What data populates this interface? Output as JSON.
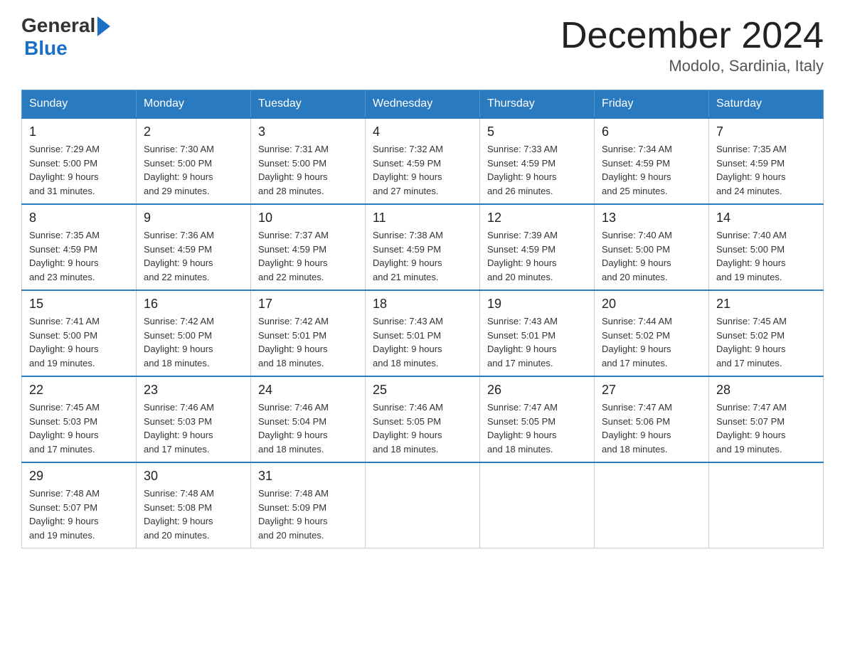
{
  "logo": {
    "general": "General",
    "blue": "Blue"
  },
  "title": "December 2024",
  "location": "Modolo, Sardinia, Italy",
  "days_of_week": [
    "Sunday",
    "Monday",
    "Tuesday",
    "Wednesday",
    "Thursday",
    "Friday",
    "Saturday"
  ],
  "weeks": [
    [
      {
        "day": 1,
        "sunrise": "7:29 AM",
        "sunset": "5:00 PM",
        "daylight": "9 hours and 31 minutes."
      },
      {
        "day": 2,
        "sunrise": "7:30 AM",
        "sunset": "5:00 PM",
        "daylight": "9 hours and 29 minutes."
      },
      {
        "day": 3,
        "sunrise": "7:31 AM",
        "sunset": "5:00 PM",
        "daylight": "9 hours and 28 minutes."
      },
      {
        "day": 4,
        "sunrise": "7:32 AM",
        "sunset": "4:59 PM",
        "daylight": "9 hours and 27 minutes."
      },
      {
        "day": 5,
        "sunrise": "7:33 AM",
        "sunset": "4:59 PM",
        "daylight": "9 hours and 26 minutes."
      },
      {
        "day": 6,
        "sunrise": "7:34 AM",
        "sunset": "4:59 PM",
        "daylight": "9 hours and 25 minutes."
      },
      {
        "day": 7,
        "sunrise": "7:35 AM",
        "sunset": "4:59 PM",
        "daylight": "9 hours and 24 minutes."
      }
    ],
    [
      {
        "day": 8,
        "sunrise": "7:35 AM",
        "sunset": "4:59 PM",
        "daylight": "9 hours and 23 minutes."
      },
      {
        "day": 9,
        "sunrise": "7:36 AM",
        "sunset": "4:59 PM",
        "daylight": "9 hours and 22 minutes."
      },
      {
        "day": 10,
        "sunrise": "7:37 AM",
        "sunset": "4:59 PM",
        "daylight": "9 hours and 22 minutes."
      },
      {
        "day": 11,
        "sunrise": "7:38 AM",
        "sunset": "4:59 PM",
        "daylight": "9 hours and 21 minutes."
      },
      {
        "day": 12,
        "sunrise": "7:39 AM",
        "sunset": "4:59 PM",
        "daylight": "9 hours and 20 minutes."
      },
      {
        "day": 13,
        "sunrise": "7:40 AM",
        "sunset": "5:00 PM",
        "daylight": "9 hours and 20 minutes."
      },
      {
        "day": 14,
        "sunrise": "7:40 AM",
        "sunset": "5:00 PM",
        "daylight": "9 hours and 19 minutes."
      }
    ],
    [
      {
        "day": 15,
        "sunrise": "7:41 AM",
        "sunset": "5:00 PM",
        "daylight": "9 hours and 19 minutes."
      },
      {
        "day": 16,
        "sunrise": "7:42 AM",
        "sunset": "5:00 PM",
        "daylight": "9 hours and 18 minutes."
      },
      {
        "day": 17,
        "sunrise": "7:42 AM",
        "sunset": "5:01 PM",
        "daylight": "9 hours and 18 minutes."
      },
      {
        "day": 18,
        "sunrise": "7:43 AM",
        "sunset": "5:01 PM",
        "daylight": "9 hours and 18 minutes."
      },
      {
        "day": 19,
        "sunrise": "7:43 AM",
        "sunset": "5:01 PM",
        "daylight": "9 hours and 17 minutes."
      },
      {
        "day": 20,
        "sunrise": "7:44 AM",
        "sunset": "5:02 PM",
        "daylight": "9 hours and 17 minutes."
      },
      {
        "day": 21,
        "sunrise": "7:45 AM",
        "sunset": "5:02 PM",
        "daylight": "9 hours and 17 minutes."
      }
    ],
    [
      {
        "day": 22,
        "sunrise": "7:45 AM",
        "sunset": "5:03 PM",
        "daylight": "9 hours and 17 minutes."
      },
      {
        "day": 23,
        "sunrise": "7:46 AM",
        "sunset": "5:03 PM",
        "daylight": "9 hours and 17 minutes."
      },
      {
        "day": 24,
        "sunrise": "7:46 AM",
        "sunset": "5:04 PM",
        "daylight": "9 hours and 18 minutes."
      },
      {
        "day": 25,
        "sunrise": "7:46 AM",
        "sunset": "5:05 PM",
        "daylight": "9 hours and 18 minutes."
      },
      {
        "day": 26,
        "sunrise": "7:47 AM",
        "sunset": "5:05 PM",
        "daylight": "9 hours and 18 minutes."
      },
      {
        "day": 27,
        "sunrise": "7:47 AM",
        "sunset": "5:06 PM",
        "daylight": "9 hours and 18 minutes."
      },
      {
        "day": 28,
        "sunrise": "7:47 AM",
        "sunset": "5:07 PM",
        "daylight": "9 hours and 19 minutes."
      }
    ],
    [
      {
        "day": 29,
        "sunrise": "7:48 AM",
        "sunset": "5:07 PM",
        "daylight": "9 hours and 19 minutes."
      },
      {
        "day": 30,
        "sunrise": "7:48 AM",
        "sunset": "5:08 PM",
        "daylight": "9 hours and 20 minutes."
      },
      {
        "day": 31,
        "sunrise": "7:48 AM",
        "sunset": "5:09 PM",
        "daylight": "9 hours and 20 minutes."
      },
      null,
      null,
      null,
      null
    ]
  ]
}
